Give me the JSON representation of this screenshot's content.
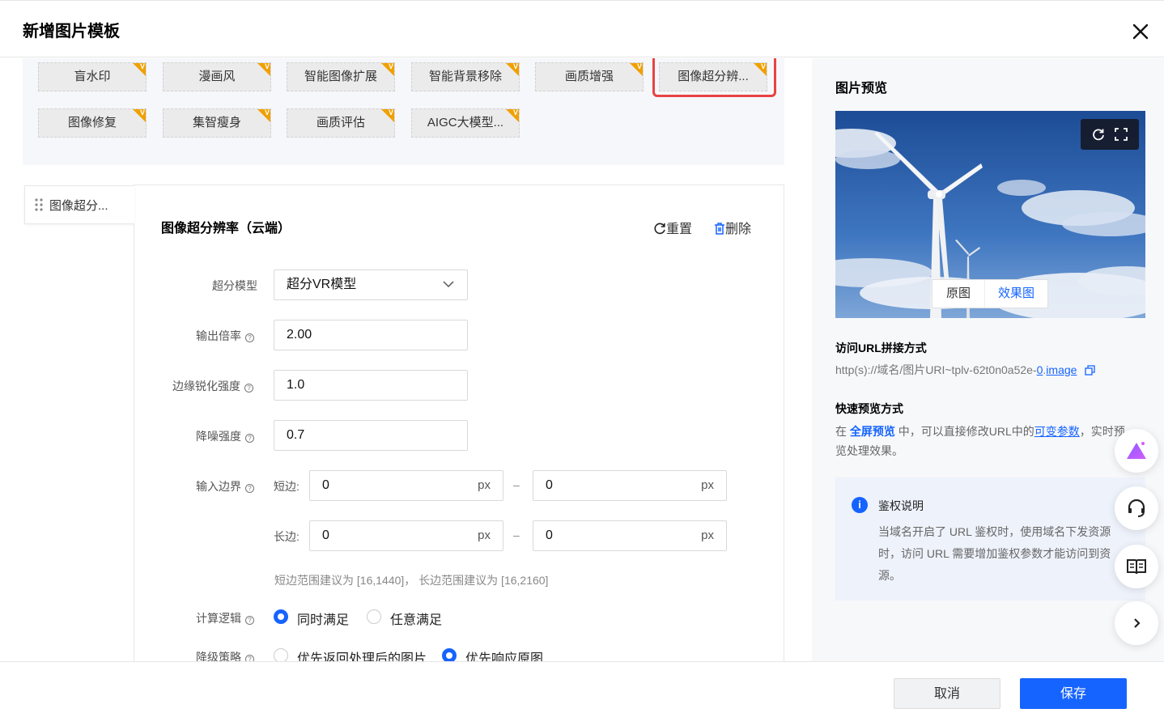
{
  "dialog": {
    "title": "新增图片模板"
  },
  "chips": [
    {
      "label": "盲水印",
      "badge": "V"
    },
    {
      "label": "漫画风",
      "badge": "V"
    },
    {
      "label": "智能图像扩展",
      "badge": "V"
    },
    {
      "label": "智能背景移除",
      "badge": "V"
    },
    {
      "label": "画质增强",
      "badge": "V"
    },
    {
      "label": "图像超分辨...",
      "badge": "V"
    },
    {
      "label": "图像修复",
      "badge": "V"
    },
    {
      "label": "集智瘦身",
      "badge": "V"
    },
    {
      "label": "画质评估",
      "badge": "V"
    },
    {
      "label": "AIGC大模型...",
      "badge": "V"
    }
  ],
  "side_tab": {
    "label": "图像超分..."
  },
  "panel": {
    "title": "图像超分辨率（云端）",
    "reset": "重置",
    "delete": "删除"
  },
  "form": {
    "model_label": "超分模型",
    "model_value": "超分VR模型",
    "scale_label": "输出倍率",
    "scale_value": "2.00",
    "sharpen_label": "边缘锐化强度",
    "sharpen_value": "1.0",
    "denoise_label": "降噪强度",
    "denoise_value": "0.7",
    "boundary_label": "输入边界",
    "short_label": "短边:",
    "long_label": "长边:",
    "short_min": "0",
    "short_max": "0",
    "long_min": "0",
    "long_max": "0",
    "unit": "px",
    "dash": "–",
    "hint": "短边范围建议为 [16,1440]， 长边范围建议为 [16,2160]",
    "logic_label": "计算逻辑",
    "logic_opt1": "同时满足",
    "logic_opt2": "任意满足",
    "downgrade_label": "降级策略",
    "downgrade_opt1": "优先返回处理后的图片",
    "downgrade_opt2": "优先响应原图"
  },
  "preview": {
    "title": "图片预览",
    "tab_original": "原图",
    "tab_effect": "效果图"
  },
  "url_section": {
    "title": "访问URL拼接方式",
    "prefix": "http(s)://域名/图片URI~tplv-62t0n0a52e-",
    "link1": "0",
    "sep": ".",
    "link2": "image"
  },
  "quick_section": {
    "title": "快速预览方式",
    "t1": "在 ",
    "full_preview": "全屏预览",
    "t2": " 中，可以直接修改URL中的",
    "var_params": "可变参数",
    "t3": "，实时预览处理效果。"
  },
  "auth": {
    "title": "鉴权说明",
    "text": "当域名开启了 URL 鉴权时，使用域名下发资源时，访问 URL 需要增加鉴权参数才能访问到资源。"
  },
  "footer": {
    "cancel": "取消",
    "save": "保存"
  },
  "colors": {
    "primary": "#1664ff",
    "badge": "#f0a000",
    "highlight": "#e84343"
  }
}
